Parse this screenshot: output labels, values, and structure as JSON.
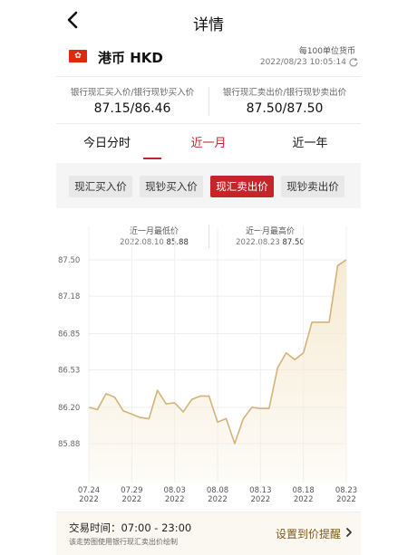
{
  "header": {
    "title": "详情",
    "back_icon": "chevron-left-icon"
  },
  "currency": {
    "flag_icon": "hong-kong-flag-icon",
    "flag_color": "#de2910",
    "name": "港币 HKD",
    "unit_note": "每100单位货币",
    "timestamp": "2022/08/23 10:05:14",
    "refresh_icon": "refresh-icon"
  },
  "prices": {
    "buy_label": "银行现汇买入价/银行现钞买入价",
    "buy_value": "87.15/86.46",
    "sell_label": "银行现汇卖出价/银行现钞卖出价",
    "sell_value": "87.50/87.50"
  },
  "periods": {
    "items": [
      "今日分时",
      "近一月",
      "近一年"
    ],
    "selected": "近一月"
  },
  "rate_types": {
    "items": [
      "现汇买入价",
      "现钞买入价",
      "现汇卖出价",
      "现钞卖出价"
    ],
    "selected": "现汇卖出价"
  },
  "stats": {
    "low_label": "近一月最低价",
    "low_date": "2022.08.10",
    "low_value": "85.88",
    "high_label": "近一月最高价",
    "high_date": "2022.08.23",
    "high_value": "87.50"
  },
  "chart_data": {
    "type": "area",
    "y_tick_labels": [
      "87.50",
      "87.18",
      "86.85",
      "86.53",
      "86.20",
      "85.88"
    ],
    "ylim": [
      85.88,
      87.5
    ],
    "x_ticks": [
      {
        "day": "07.24",
        "year": "2022"
      },
      {
        "day": "07.29",
        "year": "2022"
      },
      {
        "day": "08.03",
        "year": "2022"
      },
      {
        "day": "08.08",
        "year": "2022"
      },
      {
        "day": "08.13",
        "year": "2022"
      },
      {
        "day": "08.18",
        "year": "2022"
      },
      {
        "day": "08.23",
        "year": "2022"
      }
    ],
    "points": [
      [
        "2022-07-24",
        86.2
      ],
      [
        "2022-07-25",
        86.18
      ],
      [
        "2022-07-26",
        86.32
      ],
      [
        "2022-07-27",
        86.29
      ],
      [
        "2022-07-28",
        86.17
      ],
      [
        "2022-07-29",
        86.14
      ],
      [
        "2022-07-30",
        86.11
      ],
      [
        "2022-07-31",
        86.1
      ],
      [
        "2022-08-01",
        86.35
      ],
      [
        "2022-08-02",
        86.23
      ],
      [
        "2022-08-03",
        86.24
      ],
      [
        "2022-08-04",
        86.16
      ],
      [
        "2022-08-05",
        86.27
      ],
      [
        "2022-08-06",
        86.3
      ],
      [
        "2022-08-07",
        86.3
      ],
      [
        "2022-08-08",
        86.07
      ],
      [
        "2022-08-09",
        86.1
      ],
      [
        "2022-08-10",
        85.88
      ],
      [
        "2022-08-11",
        86.1
      ],
      [
        "2022-08-12",
        86.2
      ],
      [
        "2022-08-13",
        86.19
      ],
      [
        "2022-08-14",
        86.19
      ],
      [
        "2022-08-15",
        86.55
      ],
      [
        "2022-08-16",
        86.68
      ],
      [
        "2022-08-17",
        86.62
      ],
      [
        "2022-08-18",
        86.68
      ],
      [
        "2022-08-19",
        86.95
      ],
      [
        "2022-08-20",
        86.95
      ],
      [
        "2022-08-21",
        86.95
      ],
      [
        "2022-08-22",
        87.45
      ],
      [
        "2022-08-23",
        87.5
      ]
    ],
    "line_color": "#d4b37a",
    "fill_color": "#f6ead2",
    "grid": true
  },
  "footer": {
    "trade_time": "交易时间：07:00 - 23:00",
    "note": "该走势图使用银行现汇卖出价绘制",
    "alert_link": "设置到价提醒",
    "arrow_icon": "chevron-right-icon"
  }
}
